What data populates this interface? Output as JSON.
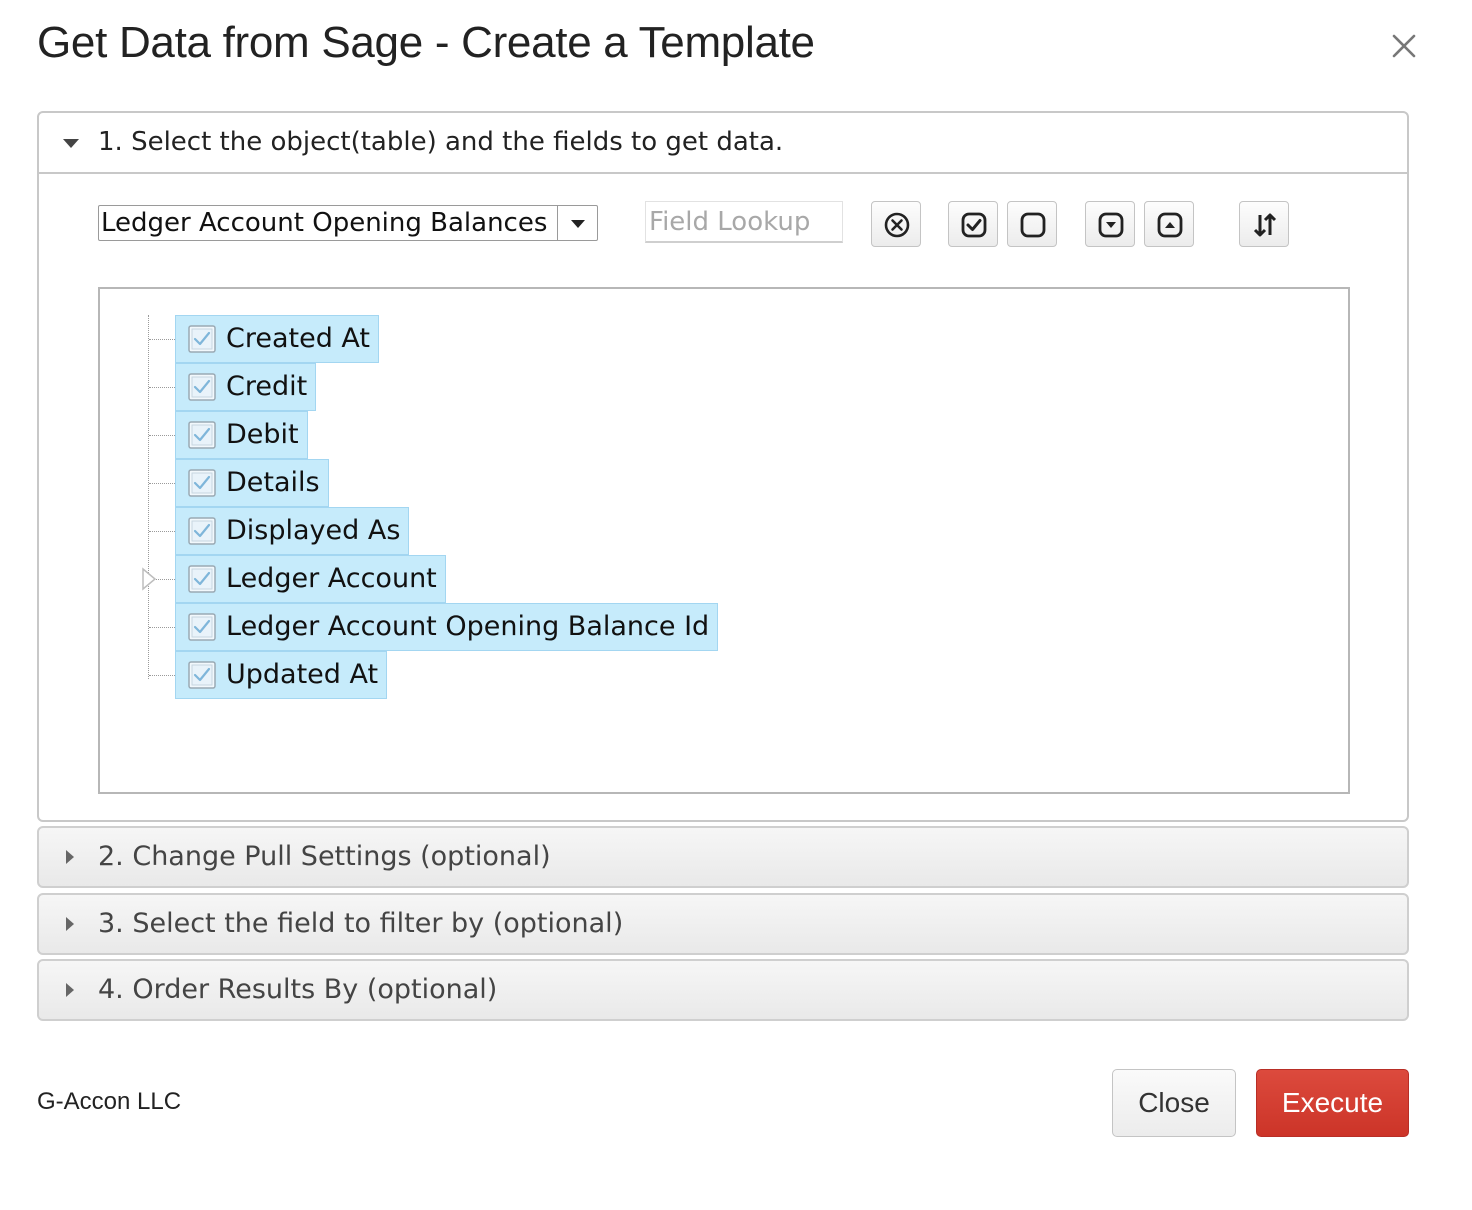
{
  "dialog": {
    "title": "Get Data from Sage - Create a Template",
    "close_icon": "close-icon"
  },
  "step1": {
    "title": "1. Select the object(table) and the fields to get data.",
    "object_select": {
      "value": "Ledger Account Opening Balances"
    },
    "field_lookup": {
      "placeholder": "Field Lookup",
      "value": ""
    },
    "toolbar_icons": [
      "clear-filter-icon",
      "select-all-icon",
      "deselect-all-icon",
      "collapse-all-icon",
      "expand-all-icon",
      "sort-icon"
    ],
    "fields": [
      {
        "label": "Created At",
        "checked": true,
        "expandable": false
      },
      {
        "label": "Credit",
        "checked": true,
        "expandable": false
      },
      {
        "label": "Debit",
        "checked": true,
        "expandable": false
      },
      {
        "label": "Details",
        "checked": true,
        "expandable": false
      },
      {
        "label": "Displayed As",
        "checked": true,
        "expandable": false
      },
      {
        "label": "Ledger Account",
        "checked": true,
        "expandable": true
      },
      {
        "label": "Ledger Account Opening Balance Id",
        "checked": true,
        "expandable": false
      },
      {
        "label": "Updated At",
        "checked": true,
        "expandable": false
      }
    ]
  },
  "sections": [
    {
      "title": "2. Change Pull Settings (optional)"
    },
    {
      "title": "3. Select the field to filter by (optional)"
    },
    {
      "title": "4. Order Results By (optional)"
    }
  ],
  "footer": {
    "company": "G-Accon LLC",
    "close_label": "Close",
    "execute_label": "Execute"
  },
  "colors": {
    "selected_node_bg": "#c6ebfb",
    "execute_button": "#d43f33"
  }
}
